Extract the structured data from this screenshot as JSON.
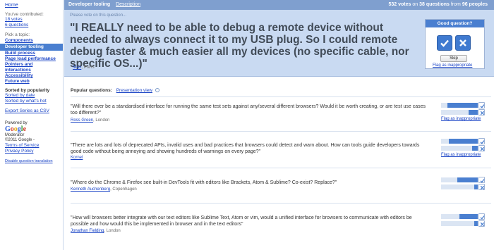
{
  "sidebar": {
    "home": "Home",
    "contributed_label": "You've contributed:",
    "votes": "18 votes",
    "questions": "6 questions",
    "pick_topic": "Pick a topic:",
    "topics": [
      {
        "label": "Components",
        "active": false
      },
      {
        "label": "Developer tooling",
        "active": true
      },
      {
        "label": "Build process",
        "active": false
      },
      {
        "label": "Page load performance",
        "active": false
      },
      {
        "label": "Pointers and interactions",
        "active": false
      },
      {
        "label": "Accessibility",
        "active": false
      },
      {
        "label": "Future web",
        "active": false
      }
    ],
    "sorted_by": "Sorted by popularity",
    "sort_date": "Sorted by date",
    "sort_hot": "Sorted by what's hot",
    "export": "Export Series as CSV",
    "powered_by": "Powered by",
    "google": "Google",
    "moderator": "Moderator",
    "copyright": "©2011 Google -",
    "terms": "Terms of Service",
    "privacy": "Privacy Policy",
    "disable_translation": "Disable question translation"
  },
  "topbar": {
    "topic": "Developer tooling",
    "description": "Description",
    "votes": "532 votes",
    "on": "on",
    "questions": "38 questions",
    "from": "from",
    "people": "96 peoples"
  },
  "feature": {
    "prompt": "Please vote on this question...",
    "question": "\"I REALLY need to be able to debug a remote device without needed to always connect it to my USB plug. So I could remote debug faster & much easier all my devices (no specific cable, nor specific OS...)\"",
    "author": "Max",
    "location": ", Paris",
    "good_question": "Good question?",
    "skip": "Skip",
    "flag": "Flag as inappropriate"
  },
  "popular": {
    "heading": "Popular questions:",
    "presentation": "Presentation view",
    "questions": [
      {
        "text": "\"Will there ever be a standardised interface for running the same test sets against any/several different browsers? Would it be worth creating, or are test use cases too different?\"",
        "author": "Ross Green",
        "location": ", London",
        "flag": "Flag as inappropriate",
        "up": 0.82,
        "down": 0.25
      },
      {
        "text": "\"There are lots and lots of deprecated APIs, invalid uses and bad practices that browsers could detect and warn about. How can tools guide developers towards good code without being annoying and showing hundreds of warnings on every page?\"",
        "author": "Kornel",
        "location": "",
        "flag": "Flag as inappropriate",
        "up": 0.78,
        "down": 0.15
      },
      {
        "text": "\"Where do the Chrome & Firefox see built-in DevTools fit with editors like Brackets, Atom & Sublime? Co-exist? Replace?\"",
        "author": "Kenneth Auchenberg",
        "location": ", Copenhagen",
        "flag": "",
        "up": 0.55,
        "down": 0.1
      },
      {
        "text": "\"How will browsers better integrate with our text editors like Sublime Text, Atom or vim, would a unified interface for browsers to communicate with editors be possible and how would this be implemented in browser and in the text editors\"",
        "author": "Jonathan Fielding",
        "location": ", London",
        "flag": "",
        "up": 0.5,
        "down": 0.1
      }
    ]
  },
  "colors": {
    "accent": "#4a7fd0",
    "header": "#7f9fcf",
    "feature_bg": "#c9daf2",
    "link": "#1a44c6"
  }
}
